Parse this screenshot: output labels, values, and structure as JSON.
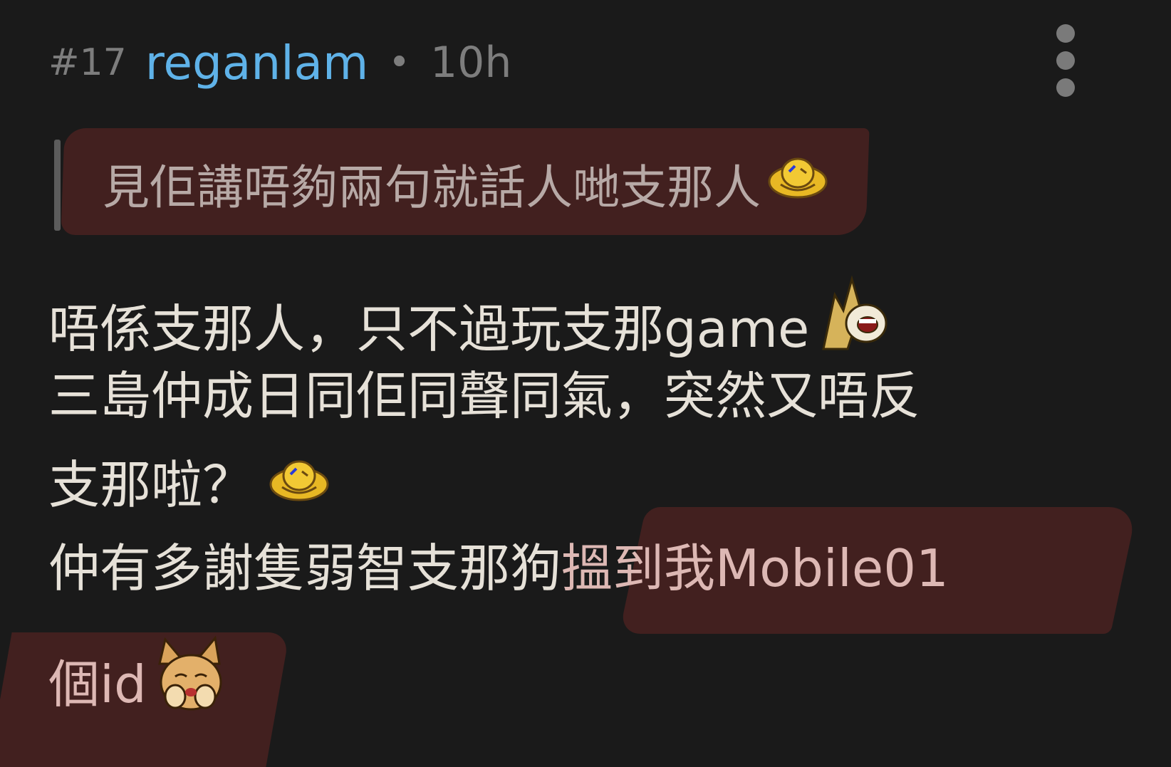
{
  "post": {
    "number": "#17",
    "username": "reganlam",
    "separator": "•",
    "time": "10h"
  },
  "quote": {
    "text": "見佢講唔夠兩句就話人哋支那人",
    "emoji": "laughing-face-emoji"
  },
  "body": {
    "line1_text": "唔係支那人，只不過玩支那game",
    "line1_emoji": "shocked-horse-emoji",
    "line2_text": "三島仲成日同佢同聲同氣，突然又唔反",
    "line3_text": "支那啦？",
    "line3_emoji": "laughing-face-emoji",
    "line4_text_a": "仲有多謝隻弱智支那狗",
    "line4_text_b": "搵到我Mobile01",
    "line5_text": "個id",
    "line5_emoji": "crying-cat-emoji"
  },
  "colors": {
    "background": "#1a1a1a",
    "username": "#5fb2e8",
    "meta": "#7d7d7d",
    "text": "#e6e1d8",
    "redaction": "#42201f"
  }
}
